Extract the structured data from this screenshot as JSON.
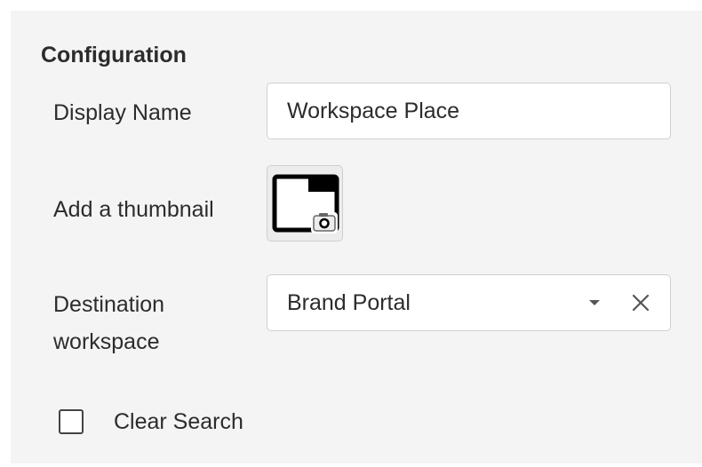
{
  "configuration": {
    "title": "Configuration",
    "display_name": {
      "label": "Display Name",
      "value": "Workspace Place"
    },
    "thumbnail": {
      "label": "Add a thumbnail",
      "icon": "image-camera-icon"
    },
    "destination": {
      "label": "Destination workspace",
      "selected": "Brand Portal",
      "caret_icon": "caret-down-icon",
      "clear_icon": "close-icon"
    },
    "clear_search": {
      "label": "Clear Search",
      "checked": false
    }
  },
  "colors": {
    "panel_background": "#f4f4f4",
    "input_border": "#d0d0d0",
    "text": "#2c2c2c"
  }
}
